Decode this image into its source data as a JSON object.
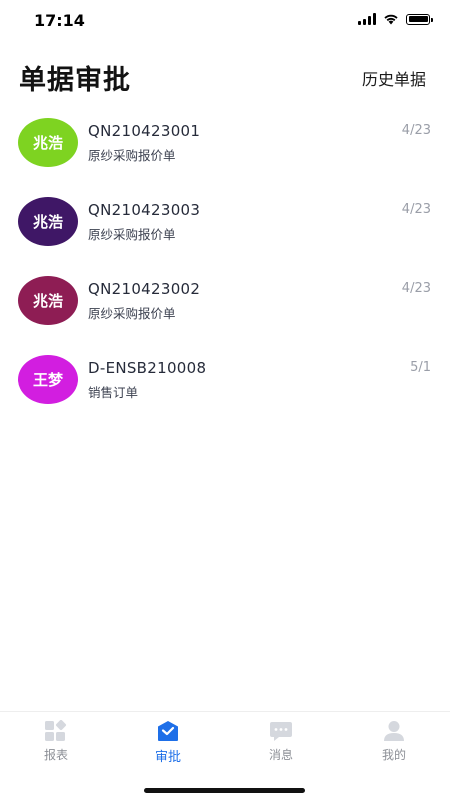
{
  "status_bar": {
    "time": "17:14",
    "battery_level": 1.0
  },
  "header": {
    "title": "单据审批",
    "history_label": "历史单据"
  },
  "approvals": [
    {
      "avatar_text": "兆浩",
      "avatar_color": "#7ed321",
      "doc_no": "QN210423001",
      "doc_type": "原纱采购报价单",
      "date": "4/23"
    },
    {
      "avatar_text": "兆浩",
      "avatar_color": "#3f1766",
      "doc_no": "QN210423003",
      "doc_type": "原纱采购报价单",
      "date": "4/23"
    },
    {
      "avatar_text": "兆浩",
      "avatar_color": "#8e1d54",
      "doc_no": "QN210423002",
      "doc_type": "原纱采购报价单",
      "date": "4/23"
    },
    {
      "avatar_text": "王梦",
      "avatar_color": "#d21ee0",
      "doc_no": "D-ENSB210008",
      "doc_type": "销售订单",
      "date": "5/1"
    }
  ],
  "tabs": [
    {
      "label": "报表",
      "icon": "report-icon",
      "active": false
    },
    {
      "label": "审批",
      "icon": "approval-icon",
      "active": true
    },
    {
      "label": "消息",
      "icon": "message-icon",
      "active": false
    },
    {
      "label": "我的",
      "icon": "profile-icon",
      "active": false
    }
  ],
  "colors": {
    "accent": "#1e6fe8",
    "inactive_icon": "#d5d8de"
  }
}
